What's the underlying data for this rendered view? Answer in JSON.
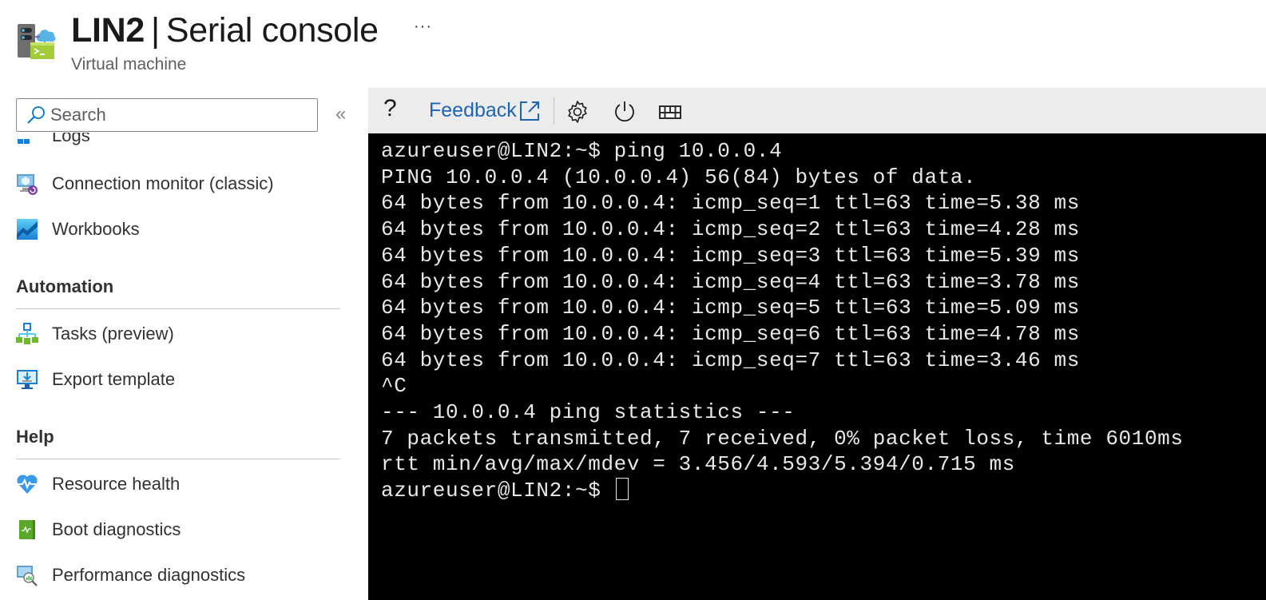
{
  "header": {
    "resource_name": "LIN2",
    "separator": "|",
    "section_title": "Serial console",
    "subtitle": "Virtual machine",
    "more_label": "···",
    "icon": "vm-serial-console-icon"
  },
  "sidebar": {
    "search": {
      "placeholder": "Search",
      "value": ""
    },
    "collapse_label": "«",
    "items_top": [
      {
        "label": "Logs",
        "icon": "logs-icon",
        "partially_visible": true
      },
      {
        "label": "Connection monitor (classic)",
        "icon": "connection-monitor-icon"
      },
      {
        "label": "Workbooks",
        "icon": "workbooks-icon"
      }
    ],
    "sections": [
      {
        "heading": "Automation",
        "items": [
          {
            "label": "Tasks (preview)",
            "icon": "tasks-icon"
          },
          {
            "label": "Export template",
            "icon": "export-template-icon"
          }
        ]
      },
      {
        "heading": "Help",
        "items": [
          {
            "label": "Resource health",
            "icon": "resource-health-icon"
          },
          {
            "label": "Boot diagnostics",
            "icon": "boot-diagnostics-icon"
          },
          {
            "label": "Performance diagnostics",
            "icon": "performance-diagnostics-icon"
          }
        ]
      }
    ]
  },
  "toolbar": {
    "help_label": "?",
    "feedback_label": "Feedback",
    "icons": [
      "help-icon",
      "external-link-icon",
      "settings-icon",
      "power-icon",
      "keyboard-icon"
    ]
  },
  "terminal": {
    "lines": [
      "azureuser@LIN2:~$ ping 10.0.0.4",
      "PING 10.0.0.4 (10.0.0.4) 56(84) bytes of data.",
      "64 bytes from 10.0.0.4: icmp_seq=1 ttl=63 time=5.38 ms",
      "64 bytes from 10.0.0.4: icmp_seq=2 ttl=63 time=4.28 ms",
      "64 bytes from 10.0.0.4: icmp_seq=3 ttl=63 time=5.39 ms",
      "64 bytes from 10.0.0.4: icmp_seq=4 ttl=63 time=3.78 ms",
      "64 bytes from 10.0.0.4: icmp_seq=5 ttl=63 time=5.09 ms",
      "64 bytes from 10.0.0.4: icmp_seq=6 ttl=63 time=4.78 ms",
      "64 bytes from 10.0.0.4: icmp_seq=7 ttl=63 time=3.46 ms",
      "^C",
      "--- 10.0.0.4 ping statistics ---",
      "7 packets transmitted, 7 received, 0% packet loss, time 6010ms",
      "rtt min/avg/max/mdev = 3.456/4.593/5.394/0.715 ms"
    ],
    "prompt": "azureuser@LIN2:~$ "
  },
  "colors": {
    "link_blue": "#1e64b4",
    "toolbar_bg": "#ececec",
    "terminal_bg": "#000000",
    "terminal_fg": "#e8e8e8"
  }
}
